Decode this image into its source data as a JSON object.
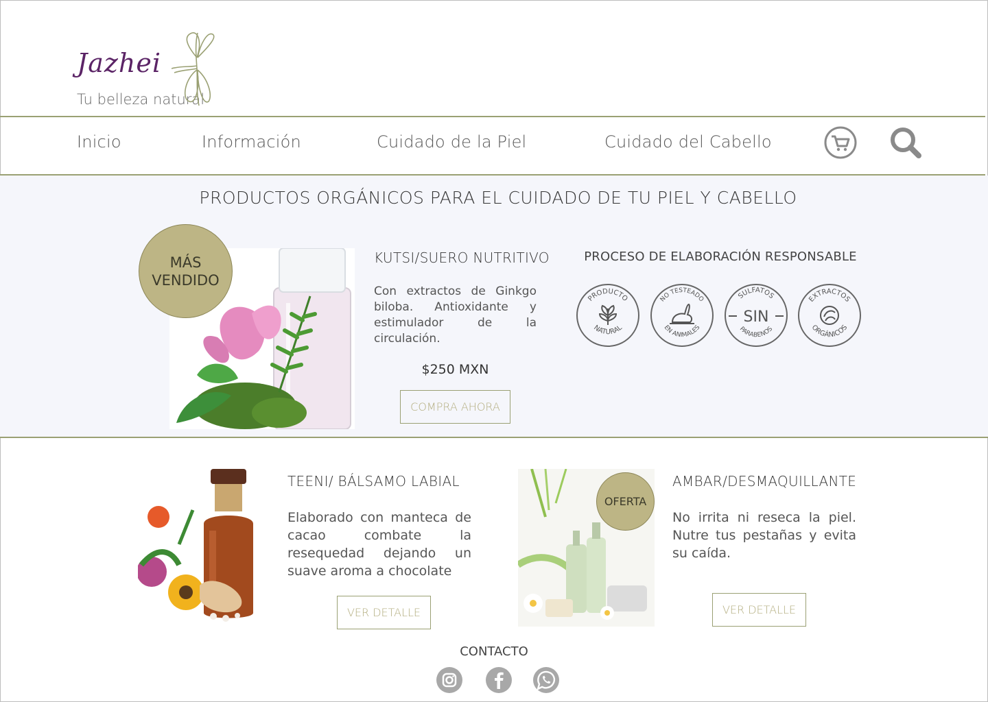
{
  "brand": {
    "name": "Jazhei",
    "tagline": "Tu belleza natural"
  },
  "nav": {
    "items": [
      {
        "label": "Inicio"
      },
      {
        "label": "Información"
      },
      {
        "label": "Cuidado de la Piel"
      },
      {
        "label": "Cuidado del Cabello"
      }
    ],
    "icons": [
      "cart-icon",
      "search-icon"
    ]
  },
  "hero": {
    "title": "PRODUCTOS ORGÁNICOS PARA EL CUIDADO DE TU PIEL Y CABELLO",
    "badge_line1": "MÁS",
    "badge_line2": "VENDIDO",
    "product": {
      "title": "KUTSI/SUERO NUTRITIVO",
      "description": "Con extractos de Ginkgo biloba. Antioxidante y estimulador de la circulación.",
      "price": "$250 MXN",
      "button": "COMPRA AHORA"
    },
    "process": {
      "title": "PROCESO DE ELABORACIÓN RESPONSABLE",
      "seals": [
        {
          "top": "PRODUCTO",
          "bottom": "NATURAL"
        },
        {
          "top": "NO TESTEADO",
          "bottom": "EN ANIMALES"
        },
        {
          "top": "SULFATOS",
          "middle": "SIN",
          "bottom": "PARABENOS"
        },
        {
          "top": "EXTRACTOS",
          "bottom": "ORGÁNICOS"
        }
      ]
    }
  },
  "products": [
    {
      "title": "TEENI/ BÁLSAMO LABIAL",
      "description": "Elaborado con manteca de cacao combate la resequedad dejando un suave aroma a chocolate",
      "button": "VER DETALLE"
    },
    {
      "title": "AMBAR/DESMAQUILLANTE",
      "badge": "OFERTA",
      "description": "No irrita ni reseca la piel. Nutre  tus pestañas y evita su caída.",
      "button": "VER DETALLE"
    }
  ],
  "contact": {
    "title": "CONTACTO",
    "icons": [
      "instagram-icon",
      "facebook-icon",
      "whatsapp-icon"
    ]
  },
  "colors": {
    "accent": "#9aa073",
    "badge": "#bdb585",
    "brand": "#5b2466",
    "hero_bg": "#f5f6fb"
  }
}
